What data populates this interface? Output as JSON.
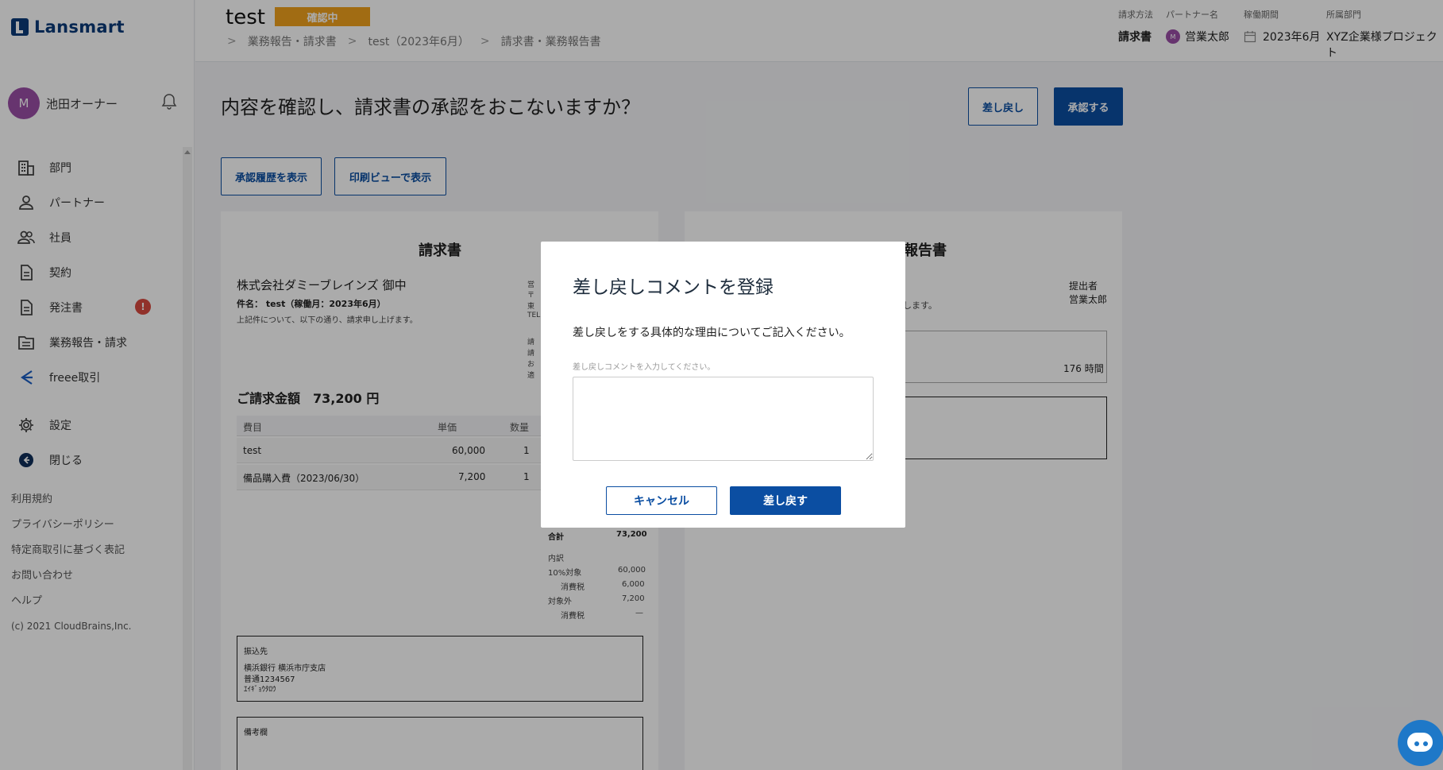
{
  "app": {
    "logo": "Lansmart"
  },
  "sidebar": {
    "user_initial": "M",
    "user_name": "池田オーナー",
    "items": [
      {
        "label": "部門",
        "icon": "building-icon"
      },
      {
        "label": "パートナー",
        "icon": "person-icon"
      },
      {
        "label": "社員",
        "icon": "people-icon"
      },
      {
        "label": "契約",
        "icon": "document-icon"
      },
      {
        "label": "発注書",
        "icon": "document-icon",
        "badge": "!"
      },
      {
        "label": "業務報告・請求",
        "icon": "folder-icon"
      },
      {
        "label": "freee取引",
        "icon": "freee-icon"
      },
      {
        "label": "設定",
        "icon": "gear-icon"
      },
      {
        "label": "閉じる",
        "icon": "arrow-left-icon"
      }
    ],
    "links": [
      "利用規約",
      "プライバシーポリシー",
      "特定商取引に基づく表記",
      "お問い合わせ",
      "ヘルプ"
    ],
    "copyright": "(c) 2021 CloudBrains,Inc."
  },
  "header": {
    "title": "test",
    "status": "確認中",
    "breadcrumb": [
      "業務報告・請求書",
      "test（2023年6月）",
      "請求書・業務報告書"
    ],
    "meta": {
      "method_label": "請求方法",
      "method_value": "請求書",
      "partner_label": "パートナー名",
      "partner_value": "営業太郎",
      "partner_initial": "M",
      "period_label": "稼働期間",
      "period_value": "2023年6月",
      "dept_label": "所属部門",
      "dept_value": "XYZ企業様プロジェクト"
    }
  },
  "main": {
    "question": "内容を確認し、請求書の承認をおこないますか？",
    "reject_button": "差し戻し",
    "approve_button": "承認する",
    "history_button": "承認履歴を表示",
    "print_button": "印刷ビューで表示",
    "invoice": {
      "title": "請求書",
      "to": "株式会社ダミーブレインズ 御中",
      "subject": "件名： test（稼働月：2023年6月）",
      "note": "上記件について、以下の通り、請求申し上げます。",
      "side_chars": [
        "営",
        "〒",
        "東",
        "TEL",
        "請",
        "請",
        "お",
        "適"
      ],
      "amount_label": "ご請求金額　73,200 円",
      "columns": [
        "費目",
        "単価",
        "数量"
      ],
      "rows": [
        {
          "item": "test",
          "price": "60,000",
          "qty": "1"
        },
        {
          "item": "備品購入費（2023/06/30）",
          "price": "7,200",
          "qty": "1"
        }
      ],
      "totals": [
        {
          "label": "合計",
          "value": "73,200"
        },
        {
          "label": "内訳",
          "value": ""
        },
        {
          "label": "10%対象",
          "value": "60,000"
        },
        {
          "label": "消費税",
          "value": "6,000"
        },
        {
          "label": "対象外",
          "value": "7,200"
        },
        {
          "label": "消費税",
          "value": "—"
        }
      ],
      "bank_title": "振込先",
      "bank_lines": [
        "横浜銀行 横浜市庁支店",
        "普通1234567",
        "ｴｲｷﾞｮｳﾀﾛｳ"
      ],
      "remarks_title": "備考欄"
    },
    "report": {
      "title_suffix": "報告書",
      "submitter_label": "提出者",
      "submitter_name": "営業太郎",
      "note_tail": "たします。",
      "hours": "176 時間"
    }
  },
  "modal": {
    "title": "差し戻しコメントを登録",
    "description": "差し戻しをする具体的な理由についてご記入ください。",
    "placeholder_label": "差し戻しコメントを入力してください。",
    "comment": "",
    "cancel": "キャンセル",
    "submit": "差し戻す"
  },
  "colors": {
    "primary": "#0b4ea2",
    "status": "#f1a21d",
    "badge": "#d94a3f",
    "avatar": "#9a4ea6"
  }
}
